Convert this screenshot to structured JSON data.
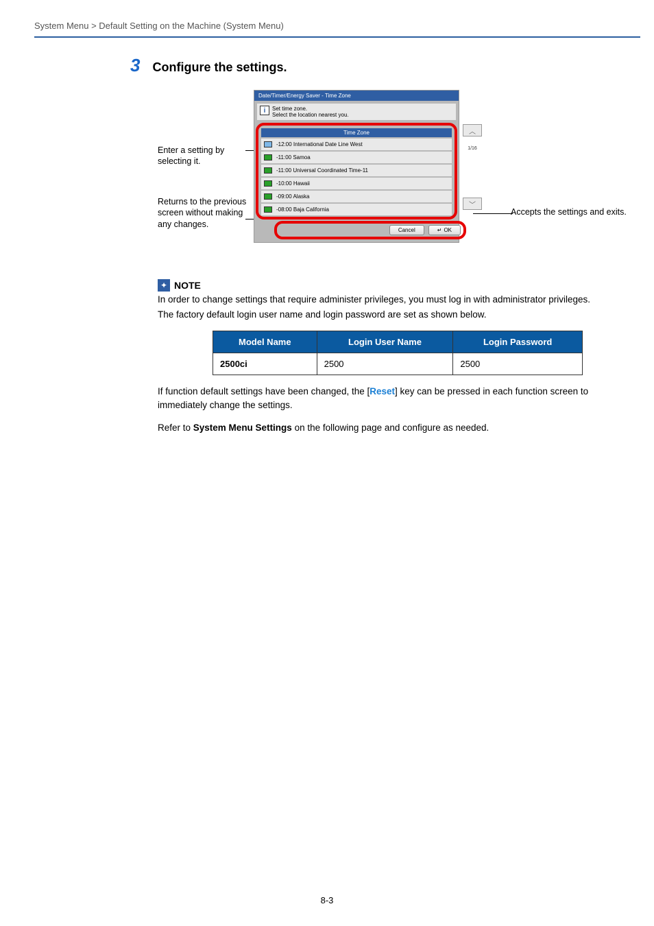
{
  "breadcrumb": "System Menu > Default Setting on the Machine (System Menu)",
  "step": {
    "number": "3",
    "title": "Configure the settings."
  },
  "panel": {
    "header": "Date/Timer/Energy Saver - Time Zone",
    "info_line1": "Set time zone.",
    "info_line2": "Select the location nearest you.",
    "list_title": "Time Zone",
    "items": [
      "-12:00 International Date Line West",
      "-11:00 Samoa",
      "-11:00 Universal Coordinated Time-11",
      "-10:00 Hawaii",
      "-09:00 Alaska",
      "-08:00 Baja California"
    ],
    "page_indicator": "1/16",
    "btn_cancel": "Cancel",
    "btn_ok": "OK"
  },
  "callouts": {
    "select": "Enter a setting by selecting it.",
    "cancel": "Returns to the previous screen without making any changes.",
    "ok": "Accepts the settings and exits."
  },
  "note": {
    "label": "NOTE",
    "para1": "In order to change settings that require administer privileges, you must log in with administrator privileges.",
    "para2": "The factory default login user name and login password are set as shown below."
  },
  "table": {
    "headers": [
      "Model Name",
      "Login User Name",
      "Login Password"
    ],
    "rows": [
      {
        "model": "2500ci",
        "user": "2500",
        "pass": "2500"
      }
    ]
  },
  "after_table_1_pre": "If function default settings have been changed, the [",
  "after_table_1_key": "Reset",
  "after_table_1_post": "] key can be pressed in each function screen to immediately change the settings.",
  "after_table_2_pre": "Refer to ",
  "after_table_2_bold": "System Menu Settings",
  "after_table_2_post": " on the following page and configure as needed.",
  "page_number": "8-3"
}
